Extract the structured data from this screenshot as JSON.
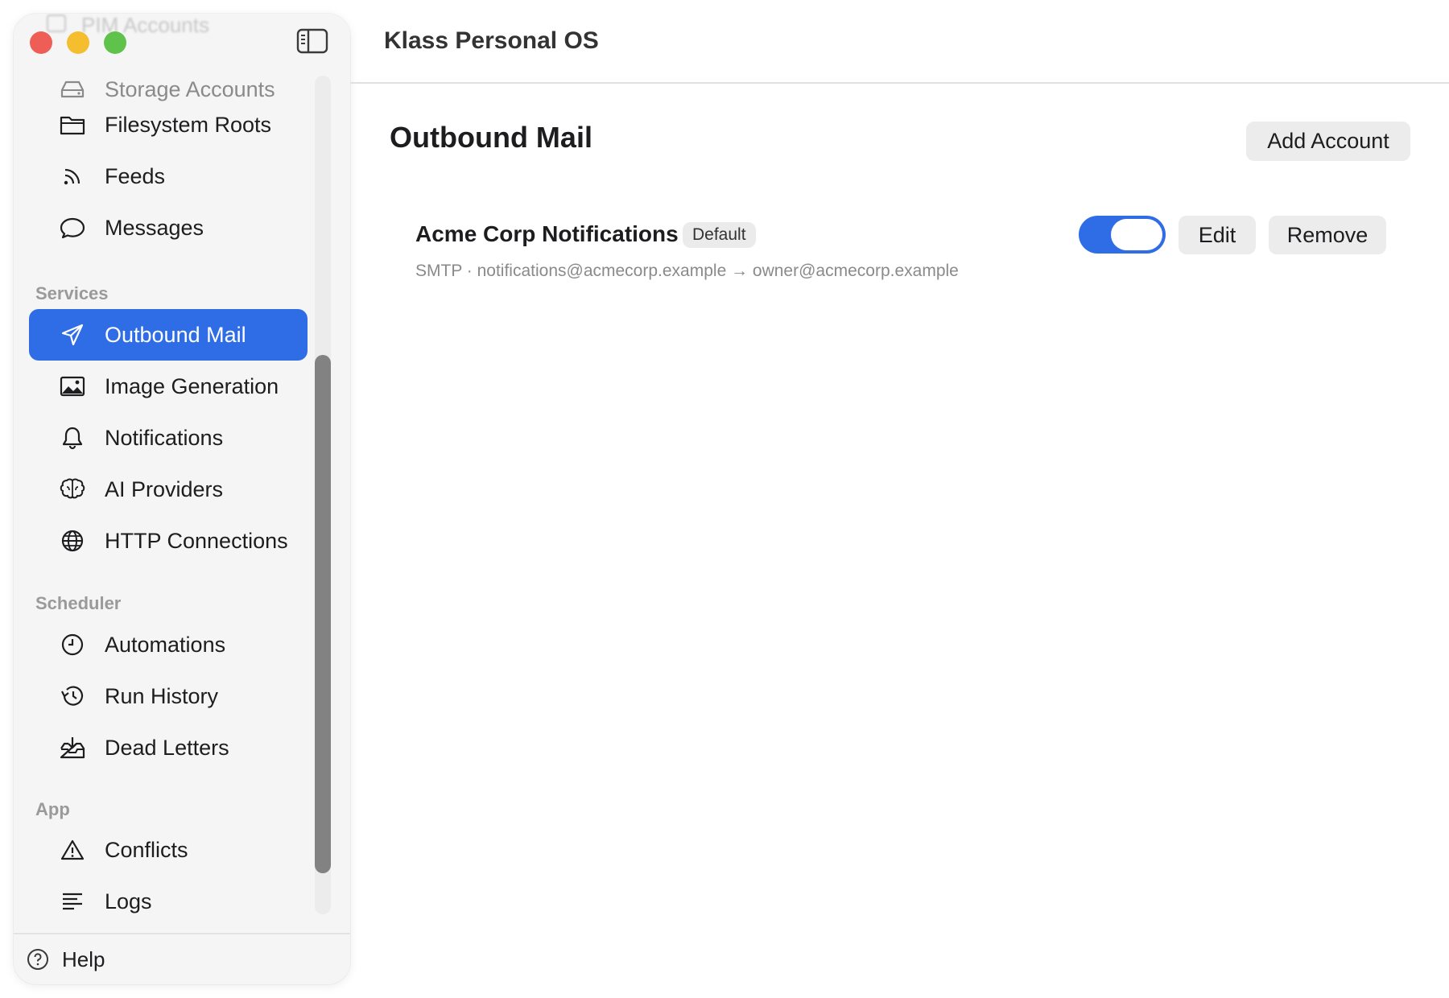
{
  "app": {
    "title": "Klass Personal OS"
  },
  "sidebar": {
    "ghost_item": {
      "label": "PIM Accounts",
      "icon": "calendar-icon"
    },
    "items": [
      {
        "key": "storage-accounts",
        "label": "Storage Accounts",
        "icon": "drive-icon"
      },
      {
        "key": "filesystem-roots",
        "label": "Filesystem Roots",
        "icon": "folder-icon"
      },
      {
        "key": "feeds",
        "label": "Feeds",
        "icon": "rss-icon"
      },
      {
        "key": "messages",
        "label": "Messages",
        "icon": "chat-bubble-icon"
      },
      {
        "key": "outbound-mail",
        "label": "Outbound Mail",
        "icon": "paper-plane-icon",
        "active": true
      },
      {
        "key": "image-generation",
        "label": "Image Generation",
        "icon": "image-icon"
      },
      {
        "key": "notifications",
        "label": "Notifications",
        "icon": "bell-icon"
      },
      {
        "key": "ai-providers",
        "label": "AI Providers",
        "icon": "brain-icon"
      },
      {
        "key": "http-connections",
        "label": "HTTP Connections",
        "icon": "globe-icon"
      },
      {
        "key": "automations",
        "label": "Automations",
        "icon": "clock-icon"
      },
      {
        "key": "run-history",
        "label": "Run History",
        "icon": "history-icon"
      },
      {
        "key": "dead-letters",
        "label": "Dead Letters",
        "icon": "tray-download-icon"
      },
      {
        "key": "conflicts",
        "label": "Conflicts",
        "icon": "warning-triangle-icon"
      },
      {
        "key": "logs",
        "label": "Logs",
        "icon": "text-lines-icon"
      }
    ],
    "sections": {
      "services": "Services",
      "scheduler": "Scheduler",
      "app": "App"
    },
    "help_label": "Help"
  },
  "main": {
    "title": "Outbound Mail",
    "add_button": "Add Account",
    "accounts": [
      {
        "name": "Acme Corp Notifications",
        "badge": "Default",
        "detail": "SMTP · notifications@acmecorp.example → owner@acmecorp.example",
        "enabled": true,
        "edit_label": "Edit",
        "remove_label": "Remove"
      }
    ]
  },
  "colors": {
    "accent": "#2f6de6",
    "sidebar_bg": "#f5f5f5",
    "traffic_close": "#ee5e56",
    "traffic_min": "#f5be2f",
    "traffic_max": "#5fc24b"
  }
}
